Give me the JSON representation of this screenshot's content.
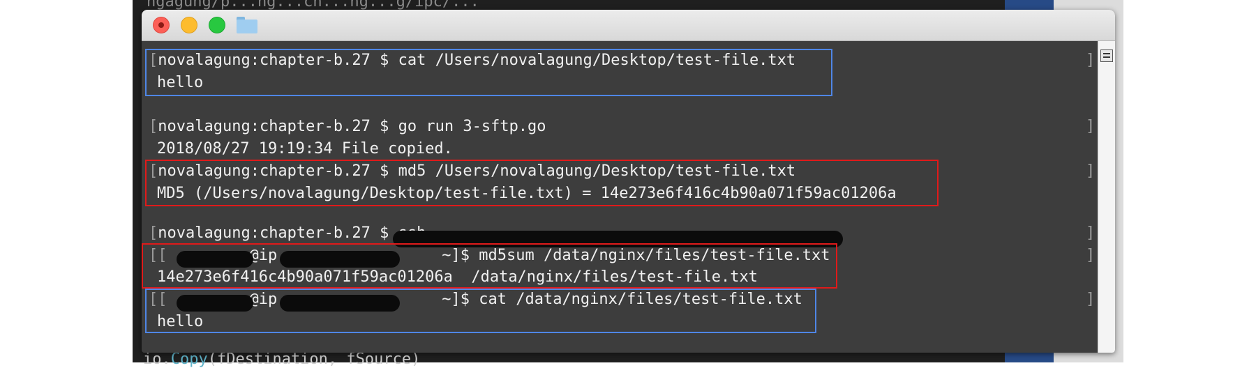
{
  "background": {
    "top_text": "ngagung/p...ng...ch...ng...g/ipc/...",
    "bottom_text_prefix": "io.",
    "bottom_text_fn": "Copy",
    "bottom_text_args": "(fDestination, fSource)"
  },
  "terminal": {
    "lines": [
      "novalagung:chapter-b.27 $ cat /Users/novalagung/Desktop/test-file.txt",
      "hello",
      "novalagung:chapter-b.27 $ go run 3-sftp.go",
      "2018/08/27 19:19:34 File copied.",
      "novalagung:chapter-b.27 $ md5 /Users/novalagung/Desktop/test-file.txt",
      "MD5 (/Users/novalagung/Desktop/test-file.txt) = 14e273e6f416c4b90a071f59ac01206a",
      "novalagung:chapter-b.27 $ ssh",
      "~]$ md5sum /data/nginx/files/test-file.txt",
      "14e273e6f416c4b90a071f59ac01206a  /data/nginx/files/test-file.txt",
      "~]$ cat /data/nginx/files/test-file.txt",
      "hello"
    ],
    "remote_prompt_partial": "@ip",
    "open_bracket": "[",
    "close_bracket": "]"
  },
  "colors": {
    "terminal_bg": "#3d3d3d",
    "text": "#f0f0f0",
    "highlight_blue": "#4f86e6",
    "highlight_red": "#e01a1a"
  },
  "icons": [
    "close-icon",
    "minimize-icon",
    "maximize-icon",
    "folder-icon",
    "scroll-menu-icon"
  ]
}
